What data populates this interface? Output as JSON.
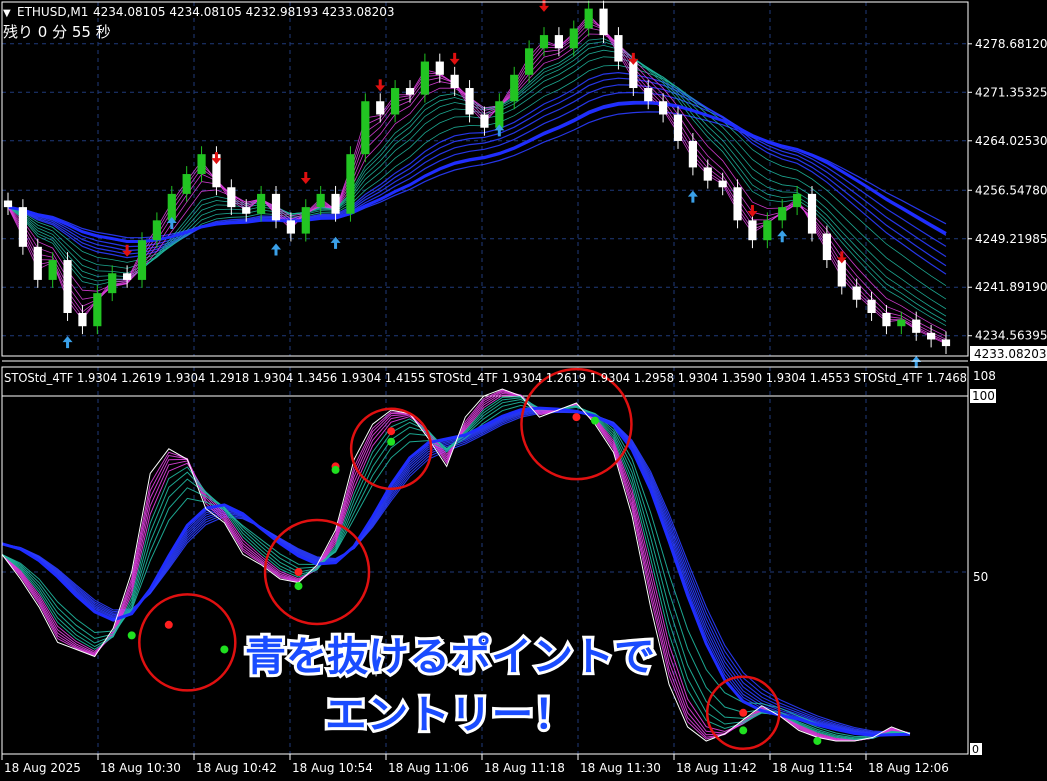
{
  "price_panel": {
    "header_label": "ETHUSD,M1",
    "ohlc": "4234.08105 4234.08105 4232.98193 4233.08203",
    "countdown": "残り 0 分 55 秒",
    "current_price_tag": "4233.08203"
  },
  "osc_panel": {
    "header": "STOStd_4TF 1.9304 1.2619 1.9304 1.2918 1.9304 1.3456 1.9304 1.4155  STOStd_4TF 1.9304 1.2619 1.9304 1.2958 1.9304 1.3590 1.9304 1.4553  STOStd_4TF 1.7468",
    "max_label": "108",
    "level_top": "100",
    "level_mid": "50",
    "level_bottom": "0"
  },
  "annotation": {
    "line1": "青を抜けるポイントで",
    "line2": "エントリー！"
  },
  "colors": {
    "background": "#000000",
    "grid": "#1f3a7a",
    "bull_candle": "#22c422",
    "bear_candle": "#ffffff",
    "sell_arrow": "#e01010",
    "buy_arrow": "#3aa0e8",
    "ribbon_slow": "#2a3cff",
    "ribbon_mid": "#20b8a0",
    "ribbon_fast": "#e040e0",
    "circle": "#e01010",
    "annotation_text": "#1a4cff"
  },
  "chart_data": [
    {
      "type": "candlestick",
      "title": "ETHUSD,M1",
      "y_ticks": [
        "4278.68120",
        "4271.35325",
        "4264.02530",
        "4256.54780",
        "4249.21985",
        "4241.89190",
        "4234.56395"
      ],
      "ylim": [
        4231.5,
        4285
      ],
      "close_path": [
        4254,
        4248,
        4243,
        4246,
        4238,
        4236,
        4241,
        4244,
        4243,
        4249,
        4252,
        4256,
        4259,
        4262,
        4257,
        4254,
        4253,
        4256,
        4252,
        4250,
        4254,
        4256,
        4253,
        4262,
        4270,
        4268,
        4272,
        4271,
        4276,
        4274,
        4272,
        4268,
        4266,
        4270,
        4274,
        4278,
        4280,
        4278,
        4281,
        4284,
        4280,
        4276,
        4272,
        4270,
        4268,
        4264,
        4260,
        4258,
        4257,
        4252,
        4249,
        4252,
        4254,
        4256,
        4250,
        4246,
        4242,
        4240,
        4238,
        4236,
        4237,
        4235,
        4234,
        4233
      ],
      "sell_arrow_candles": [
        8,
        14,
        20,
        25,
        30,
        36,
        42,
        50,
        56
      ],
      "buy_arrow_candles": [
        4,
        11,
        18,
        22,
        33,
        46,
        52,
        61
      ]
    },
    {
      "type": "line",
      "title": "STOStd_4TF",
      "ylim": [
        0,
        108
      ],
      "levels": [
        0,
        50,
        100
      ],
      "x_tick_labels": [
        "18 Aug 2025",
        "18 Aug 10:30",
        "18 Aug 10:42",
        "18 Aug 10:54",
        "18 Aug 11:06",
        "18 Aug 11:18",
        "18 Aug 11:30",
        "18 Aug 11:42",
        "18 Aug 11:54",
        "18 Aug 12:06"
      ],
      "fast_line": [
        55,
        48,
        40,
        30,
        28,
        26,
        34,
        50,
        78,
        85,
        82,
        68,
        64,
        55,
        52,
        48,
        47,
        52,
        62,
        82,
        92,
        96,
        95,
        88,
        80,
        94,
        100,
        102,
        100,
        94,
        96,
        98,
        92,
        84,
        66,
        40,
        18,
        6,
        2,
        4,
        8,
        12,
        9,
        5,
        3,
        2,
        2,
        3,
        6,
        4
      ],
      "slow_line": [
        58,
        55,
        50,
        44,
        38,
        34,
        34,
        40,
        52,
        64,
        72,
        73,
        70,
        64,
        58,
        54,
        51,
        50,
        53,
        62,
        74,
        84,
        90,
        91,
        89,
        90,
        94,
        97,
        98,
        97,
        96,
        95,
        93,
        89,
        78,
        62,
        44,
        28,
        16,
        9,
        7,
        8,
        8,
        7,
        5,
        4,
        3,
        3,
        4,
        4
      ],
      "red_dots": [
        [
          9,
          35
        ],
        [
          16,
          50
        ],
        [
          18,
          80
        ],
        [
          21,
          90
        ],
        [
          31,
          94
        ],
        [
          40,
          10
        ]
      ],
      "green_dots": [
        [
          7,
          32
        ],
        [
          12,
          28
        ],
        [
          16,
          46
        ],
        [
          18,
          79
        ],
        [
          21,
          87
        ],
        [
          32,
          93
        ],
        [
          40,
          5
        ],
        [
          44,
          2
        ]
      ]
    }
  ]
}
